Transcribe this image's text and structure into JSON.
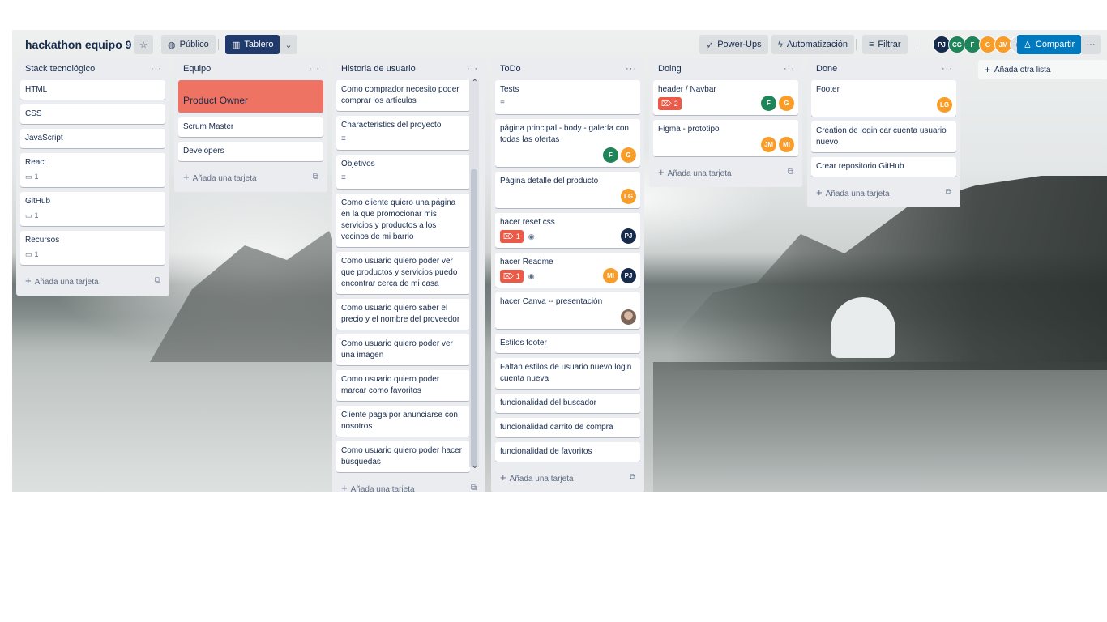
{
  "header": {
    "board_title": "hackathon equipo 9",
    "visibility_label": "Público",
    "view_label": "Tablero",
    "powerups_label": "Power-Ups",
    "automation_label": "Automatización",
    "filter_label": "Filtrar",
    "share_label": "Compartir",
    "members_more": "+4",
    "members": [
      {
        "initials": "PJ",
        "color": "#172b4d"
      },
      {
        "initials": "CG",
        "color": "#1f845a"
      },
      {
        "initials": "F",
        "color": "#1f845a"
      },
      {
        "initials": "G",
        "color": "#f99d2a"
      },
      {
        "initials": "JM",
        "color": "#f99d2a"
      }
    ]
  },
  "add_card_label": "Añada una tarjeta",
  "add_list_label": "Añada otra lista",
  "lists": [
    {
      "title": "Stack tecnológico",
      "cards": [
        {
          "title": "HTML"
        },
        {
          "title": "CSS"
        },
        {
          "title": "JavaScript"
        },
        {
          "title": "React",
          "comments": "1"
        },
        {
          "title": "GitHub",
          "comments": "1"
        },
        {
          "title": "Recursos",
          "comments": "1"
        }
      ]
    },
    {
      "title": "Equipo",
      "cards": [
        {
          "title": "Product Owner",
          "cover_color": "#ee7362"
        },
        {
          "title": "Scrum Master"
        },
        {
          "title": "Developers"
        }
      ]
    },
    {
      "title": "Historia de usuario",
      "cards": [
        {
          "title": "Como comprador necesito poder comprar los artículos"
        },
        {
          "title": "Characteristics del proyecto",
          "has_description": true
        },
        {
          "title": "Objetivos",
          "has_description": true
        },
        {
          "title": "Como cliente quiero una página en la que promocionar mis servicios y productos a los vecinos de mi barrio"
        },
        {
          "title": "Como usuario quiero poder ver que productos y servicios puedo encontrar cerca de mi casa"
        },
        {
          "title": "Como usuario quiero saber el precio y el nombre del proveedor"
        },
        {
          "title": "Como usuario quiero poder ver una imagen"
        },
        {
          "title": "Como usuario quiero poder marcar como favoritos"
        },
        {
          "title": "Cliente paga por anunciarse con nosotros"
        },
        {
          "title": "Como usuario quiero poder hacer búsquedas"
        }
      ]
    },
    {
      "title": "ToDo",
      "cards": [
        {
          "title": "Tests",
          "has_description": true
        },
        {
          "title": "página principal - body - galería con todas las ofertas",
          "members": [
            "F",
            "G"
          ]
        },
        {
          "title": "Página detalle del producto",
          "members": [
            "LG"
          ]
        },
        {
          "title": "hacer reset css",
          "attachments": "1",
          "watching": true,
          "members": [
            "PJ"
          ]
        },
        {
          "title": "hacer Readme",
          "attachments": "1",
          "watching": true,
          "members": [
            "MI",
            "PJ"
          ]
        },
        {
          "title": "hacer Canva -- presentación",
          "members": [
            "photo"
          ]
        },
        {
          "title": "Estilos footer"
        },
        {
          "title": "Faltan estilos de usuario nuevo login cuenta nueva"
        },
        {
          "title": "funcionalidad del buscador"
        },
        {
          "title": "funcionalidad carrito de compra"
        },
        {
          "title": "funcionalidad de favoritos"
        }
      ]
    },
    {
      "title": "Doing",
      "cards": [
        {
          "title": "header / Navbar",
          "attachments": "2",
          "members": [
            "F",
            "G"
          ]
        },
        {
          "title": "Figma - prototipo",
          "members": [
            "JM",
            "MI"
          ]
        }
      ]
    },
    {
      "title": "Done",
      "cards": [
        {
          "title": "Footer",
          "members": [
            "LG"
          ]
        },
        {
          "title": "Creation de login car cuenta usuario nuevo"
        },
        {
          "title": "Crear repositorio GitHub"
        }
      ]
    }
  ],
  "member_colors": {
    "F": "#1f845a",
    "G": "#f99d2a",
    "LG": "#f99d2a",
    "PJ": "#172b4d",
    "MI": "#f99d2a",
    "JM": "#f99d2a",
    "CG": "#1f845a"
  }
}
